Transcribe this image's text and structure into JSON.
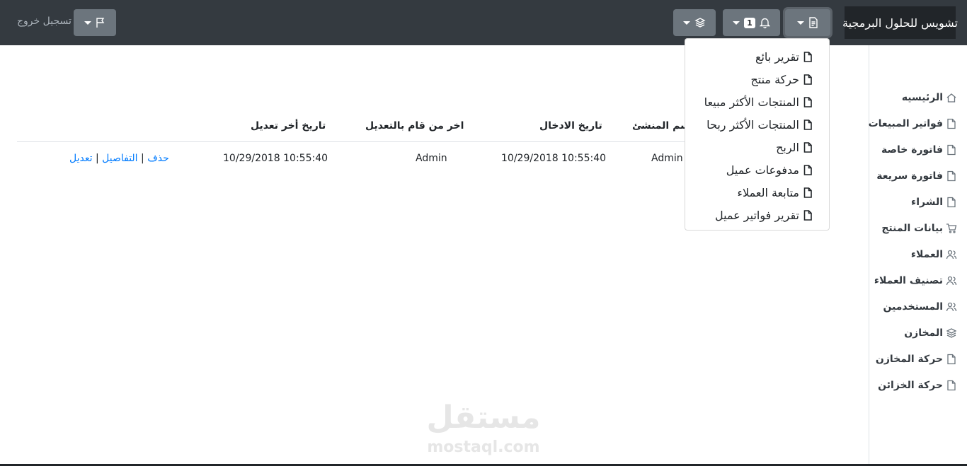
{
  "navbar": {
    "brand": "تشويس للحلول البرمجية",
    "notification_count": "1",
    "logout_label": "تسجيل خروج"
  },
  "reports_menu": {
    "items": [
      {
        "label": "تقرير بائع"
      },
      {
        "label": "حركة منتج"
      },
      {
        "label": "المنتجات الأكثر مبيعا"
      },
      {
        "label": "المنتجات الأكثر ربحا"
      },
      {
        "label": "الربح"
      },
      {
        "label": "مدفوعات عميل"
      },
      {
        "label": "متابعة العملاء"
      },
      {
        "label": "تقرير فواتير عميل"
      }
    ]
  },
  "sidebar": {
    "items": [
      {
        "label": "الرئيسيه",
        "icon": "home-icon"
      },
      {
        "label": "فواتير المبيعات",
        "icon": "file-icon"
      },
      {
        "label": "فاتورة خاصة",
        "icon": "file-icon"
      },
      {
        "label": "فاتورة سريعة",
        "icon": "file-icon"
      },
      {
        "label": "الشراء",
        "icon": "file-icon"
      },
      {
        "label": "بيانات المنتج",
        "icon": "cart-icon"
      },
      {
        "label": "العملاء",
        "icon": "users-icon"
      },
      {
        "label": "تصنيف العملاء",
        "icon": "users-icon"
      },
      {
        "label": "المستخدمين",
        "icon": "users-icon"
      },
      {
        "label": "المخازن",
        "icon": "layers-icon"
      },
      {
        "label": "حركة المخازن",
        "icon": "file-icon"
      },
      {
        "label": "حركة الخزائن",
        "icon": "file-icon"
      }
    ]
  },
  "table": {
    "headers": {
      "creator": "اسم المنشئ",
      "entry_date": "تاريخ الادخال",
      "last_modified_by": "اخر من قام بالتعديل",
      "last_modified_date": "تاريخ أخر تعديل"
    },
    "rows": [
      {
        "creator": "Admin",
        "entry_date": "10/29/2018 10:55:40",
        "last_modified_by": "Admin",
        "last_modified_date": "10/29/2018 10:55:40",
        "edit": "تعديل",
        "details": "التفاصيل",
        "delete": "حذف"
      }
    ]
  },
  "watermark": {
    "arabic": "مستقل",
    "latin": "mostaql.com"
  }
}
